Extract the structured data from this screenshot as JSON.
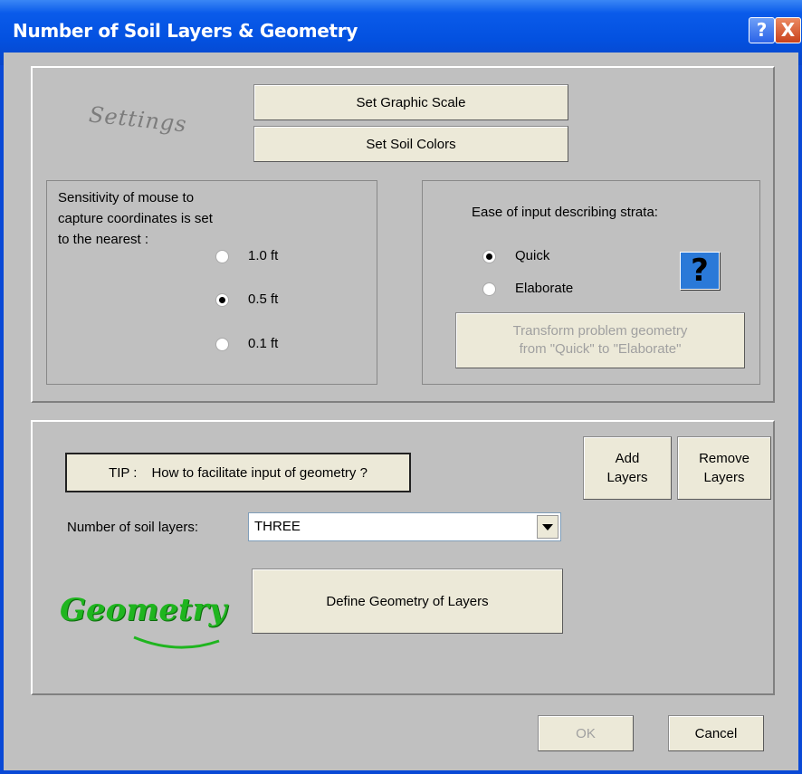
{
  "window": {
    "title": "Number of Soil Layers & Geometry",
    "help_btn": "?",
    "close_btn": "X"
  },
  "settings": {
    "logo_text": "Settings",
    "set_graphic_scale": "Set Graphic Scale",
    "set_soil_colors": "Set Soil Colors",
    "sensitivity_label_line1": "Sensitivity of mouse to",
    "sensitivity_label_line2": "capture coordinates is set",
    "sensitivity_label_line3": "to the nearest :",
    "sensitivity_options": [
      "1.0 ft",
      "0.5 ft",
      "0.1 ft"
    ],
    "sensitivity_selected": "0.5 ft",
    "ease_label": "Ease of input describing strata:",
    "ease_options": [
      "Quick",
      "Elaborate"
    ],
    "ease_selected": "Quick",
    "help_icon_glyph": "?",
    "transform_line1": "Transform problem geometry",
    "transform_line2": "from \"Quick\" to \"Elaborate\""
  },
  "geometry": {
    "tip_label": "TIP :",
    "tip_text": "How to facilitate input of geometry ?",
    "add_line1": "Add",
    "add_line2": "Layers",
    "remove_line1": "Remove",
    "remove_line2": "Layers",
    "num_layers_label": "Number of soil layers:",
    "num_layers_value": "THREE",
    "define_geometry": "Define Geometry of Layers",
    "logo_text": "Geometry"
  },
  "footer": {
    "ok": "OK",
    "cancel": "Cancel"
  },
  "colors": {
    "titlebar": "#0a5bea",
    "dialog_bg": "#c0c0c0",
    "geometry_logo": "#1fb51f",
    "help_icon_bg": "#2a79d8"
  }
}
